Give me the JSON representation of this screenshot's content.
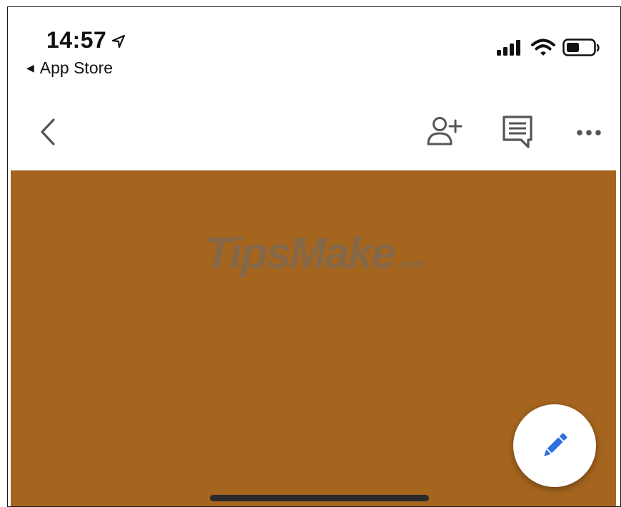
{
  "status_bar": {
    "time": "14:57",
    "back_app_label": "App Store",
    "icons": [
      "location-arrow-icon",
      "signal-bars-icon",
      "wifi-icon",
      "battery-icon"
    ]
  },
  "nav_bar": {
    "icons": [
      "back-chevron-icon",
      "add-person-icon",
      "comments-icon",
      "more-icon"
    ]
  },
  "document": {
    "background_color": "#a5651f",
    "watermark": {
      "main": "TipsMake",
      "suffix": ".com"
    }
  },
  "fab": {
    "icon": "pencil-icon",
    "icon_color": "#2f6fde"
  }
}
